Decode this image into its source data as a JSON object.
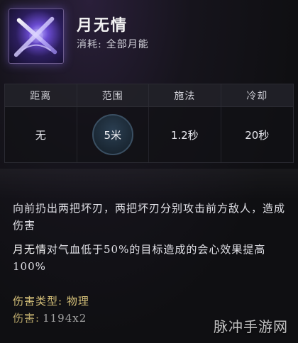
{
  "skill": {
    "name": "月无情",
    "cost_label": "消耗:",
    "cost_value": "全部月能",
    "icon_name": "crossed-blades-icon"
  },
  "stats": {
    "headers": [
      "距离",
      "范围",
      "施法",
      "冷却"
    ],
    "values": [
      "无",
      "5米",
      "1.2秒",
      "20秒"
    ]
  },
  "description": {
    "line1": "向前扔出两把坏刃，两把坏刃分别攻击前方敌人，造成伤害",
    "line2_prefix": "月无情",
    "line2_rest": "对气血低于50%的目标造成的会心效果提高100%"
  },
  "damage_type": {
    "label": "伤害类型:",
    "value": "物理"
  },
  "damage": {
    "label": "伤害:",
    "value": "1194x2"
  },
  "watermark": "脉冲手游网",
  "colors": {
    "gold": "#d7c27a",
    "panel": "#0f0f12",
    "ring": "#3a4f62"
  }
}
